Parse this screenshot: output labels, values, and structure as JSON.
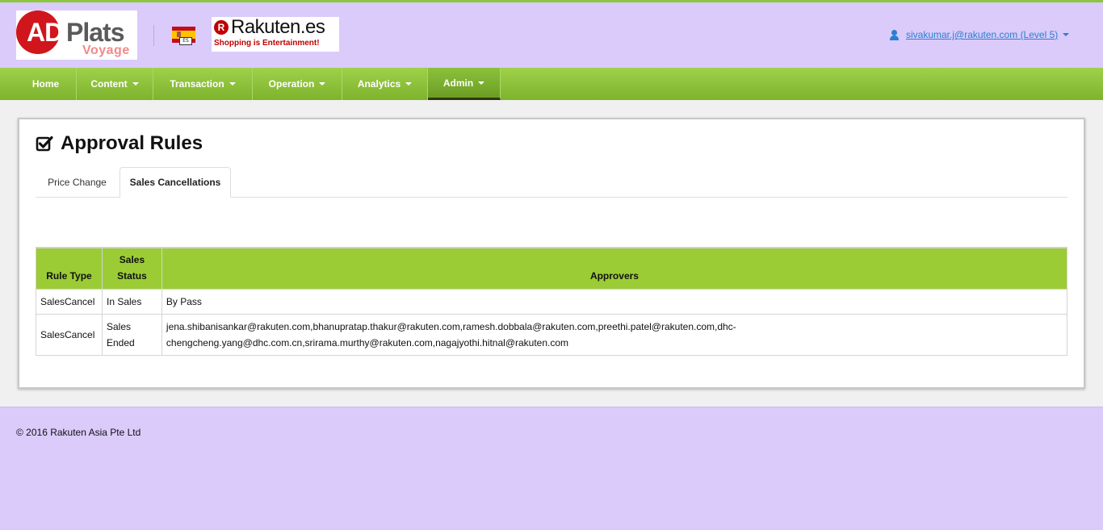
{
  "header": {
    "logo": {
      "main_prefix": "AD",
      "main_suffix": "Plats",
      "sub": "Voyage"
    },
    "flag": {
      "code": "ES",
      "colors": {
        "red": "#c60b1e",
        "yellow": "#ffc400"
      }
    },
    "partner_logo": {
      "mark": "R",
      "name": "Rakuten",
      "tld": ".es",
      "tagline": "Shopping is Entertainment!"
    },
    "user": {
      "label": "sivakumar.j@rakuten.com (Level 5)",
      "icon": "user-icon"
    }
  },
  "nav": {
    "items": [
      {
        "label": "Home",
        "dropdown": false,
        "active": false
      },
      {
        "label": "Content",
        "dropdown": true,
        "active": false
      },
      {
        "label": "Transaction",
        "dropdown": true,
        "active": false
      },
      {
        "label": "Operation",
        "dropdown": true,
        "active": false
      },
      {
        "label": "Analytics",
        "dropdown": true,
        "active": false
      },
      {
        "label": "Admin",
        "dropdown": true,
        "active": true
      }
    ]
  },
  "page": {
    "title": "Approval Rules",
    "title_icon": "checkbox-checked-icon",
    "tabs": [
      {
        "label": "Price Change",
        "active": false
      },
      {
        "label": "Sales Cancellations",
        "active": true
      }
    ]
  },
  "table": {
    "headers": [
      "Rule Type",
      "Sales Status",
      "Approvers"
    ],
    "header_lines": {
      "sales_status": [
        "Sales",
        "Status"
      ]
    },
    "rows": [
      {
        "rule_type": "SalesCancel",
        "status_lines": [
          "In Sales"
        ],
        "approvers_lines": [
          "By Pass"
        ]
      },
      {
        "rule_type": "SalesCancel",
        "status_lines": [
          "Sales",
          "Ended"
        ],
        "approvers_lines": [
          "jena.shibanisankar@rakuten.com,bhanupratap.thakur@rakuten.com,ramesh.dobbala@rakuten.com,preethi.patel@rakuten.com,dhc-",
          "chengcheng.yang@dhc.com.cn,srirama.murthy@rakuten.com,nagajyothi.hitnal@rakuten.com"
        ]
      }
    ]
  },
  "footer": {
    "copyright": "© 2016 Rakuten Asia Pte Ltd"
  },
  "colors": {
    "accent_green": "#8cc63f",
    "header_bg": "#dacbfb",
    "link_blue": "#2b7fcf",
    "table_header": "#9bcc35"
  }
}
